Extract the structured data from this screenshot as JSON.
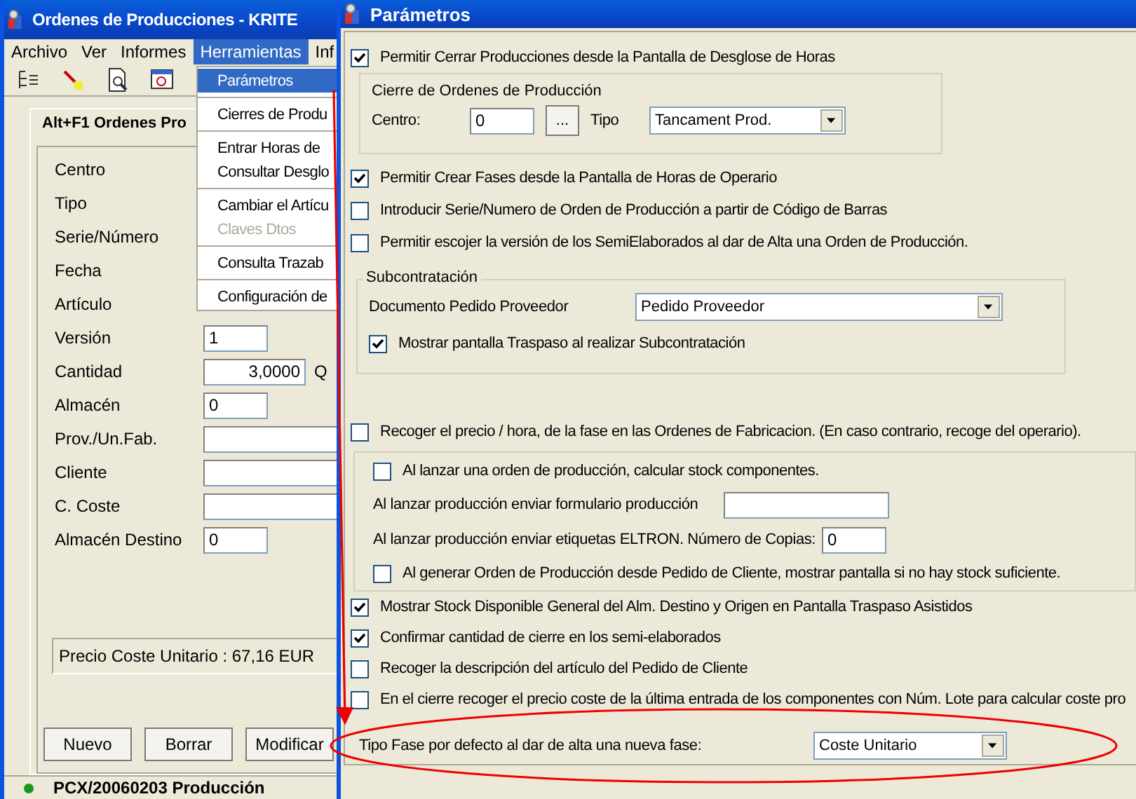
{
  "main_window": {
    "title": "Ordenes de Producciones - KRITE",
    "menu": [
      {
        "label": "Archivo",
        "selected": false
      },
      {
        "label": "Ver",
        "selected": false
      },
      {
        "label": "Informes",
        "selected": false
      },
      {
        "label": "Herramientas",
        "selected": true
      },
      {
        "label": "Inf",
        "selected": false
      }
    ],
    "dropdown_groups": [
      {
        "items": [
          {
            "label": "Parámetros",
            "selected": true,
            "disabled": false
          }
        ]
      },
      {
        "items": [
          {
            "label": "Cierres de Produ",
            "selected": false,
            "disabled": false
          }
        ]
      },
      {
        "items": [
          {
            "label": "Entrar Horas de",
            "selected": false,
            "disabled": false
          },
          {
            "label": "Consultar Desglo",
            "selected": false,
            "disabled": false
          }
        ]
      },
      {
        "items": [
          {
            "label": "Cambiar el Artícu",
            "selected": false,
            "disabled": false
          },
          {
            "label": "Claves Dtos",
            "selected": false,
            "disabled": true
          }
        ]
      },
      {
        "items": [
          {
            "label": "Consulta Trazab",
            "selected": false,
            "disabled": false
          }
        ]
      },
      {
        "items": [
          {
            "label": "Configuración de",
            "selected": false,
            "disabled": false
          }
        ]
      }
    ],
    "tab": "Alt+F1 Ordenes Pro",
    "fields": [
      {
        "label": "Centro",
        "kind": "covered"
      },
      {
        "label": "Tipo",
        "kind": "covered"
      },
      {
        "label": "Serie/Número",
        "kind": "covered"
      },
      {
        "label": "Fecha",
        "kind": "covered"
      },
      {
        "label": "Artículo",
        "kind": "covered"
      },
      {
        "label": "Versión",
        "kind": "short",
        "value": "1"
      },
      {
        "label": "Cantidad",
        "kind": "quantity",
        "value": "3,0000",
        "suffix": "Q"
      },
      {
        "label": "Almacén",
        "kind": "short",
        "value": "0"
      },
      {
        "label": "Prov./Un.Fab.",
        "kind": "wide"
      },
      {
        "label": "Cliente",
        "kind": "wide"
      },
      {
        "label": "C. Coste",
        "kind": "wide"
      },
      {
        "label": "Almacén Destino",
        "kind": "short",
        "value": "0"
      }
    ],
    "cost_line": "Precio Coste Unitario : 67,16 EUR",
    "buttons": [
      "Nuevo",
      "Borrar",
      "Modificar"
    ],
    "status": "PCX/20060203 Producción"
  },
  "parameters": {
    "title": "Parámetros",
    "close_production": {
      "label": "Permitir Cerrar Producciones desde la Pantalla de Desglose de Horas",
      "checked": true
    },
    "closing_group": {
      "title": "Cierre de Ordenes de Producción",
      "centro_label": "Centro:",
      "centro_value": "0",
      "browse": "...",
      "tipo_label": "Tipo",
      "tipo_value": "Tancament Prod."
    },
    "options_1": [
      {
        "label": "Permitir Crear Fases desde la Pantalla de Horas de Operario",
        "checked": true
      },
      {
        "label": "Introducir Serie/Numero de Orden de Producción a partir de Código de Barras",
        "checked": false
      },
      {
        "label": "Permitir escojer la versión de los SemiElaborados al dar de Alta una Orden de Producción.",
        "checked": false
      }
    ],
    "subcontracting": {
      "title": "Subcontratación",
      "document_label": "Documento Pedido Proveedor",
      "document_value": "Pedido Proveedor",
      "show_transfer": {
        "label": "Mostrar pantalla Traspaso al realizar Subcontratación",
        "checked": true
      }
    },
    "price_option": {
      "label": "Recoger el precio / hora, de la fase en las Ordenes de Fabricacion. (En caso contrario, recoge del operario).",
      "checked": false
    },
    "launch_group": {
      "calc_stock": {
        "label": "Al lanzar una orden de producción, calcular stock componentes.",
        "checked": false
      },
      "form_label": "Al lanzar producción enviar formulario producción",
      "labels_label": "Al lanzar producción enviar etiquetas ELTRON. Número de Copias:",
      "labels_value": "0",
      "stock_warning": {
        "label": "Al generar Orden de Producción desde Pedido de Cliente, mostrar pantalla si no hay stock suficiente.",
        "checked": false
      }
    },
    "options_2": [
      {
        "label": "Mostrar Stock Disponible General del Alm. Destino y Origen en Pantalla Traspaso Asistidos",
        "checked": true
      },
      {
        "label": "Confirmar cantidad de cierre en los semi-elaborados",
        "checked": true
      },
      {
        "label": "Recoger la descripción del artículo del Pedido de Cliente",
        "checked": false
      },
      {
        "label": "En el cierre recoger el precio coste de la última entrada de los componentes con Núm. Lote para calcular coste pro",
        "checked": false
      }
    ],
    "default_phase": {
      "label": "Tipo Fase por defecto al dar de alta una nueva fase:",
      "value": "Coste Unitario"
    }
  }
}
